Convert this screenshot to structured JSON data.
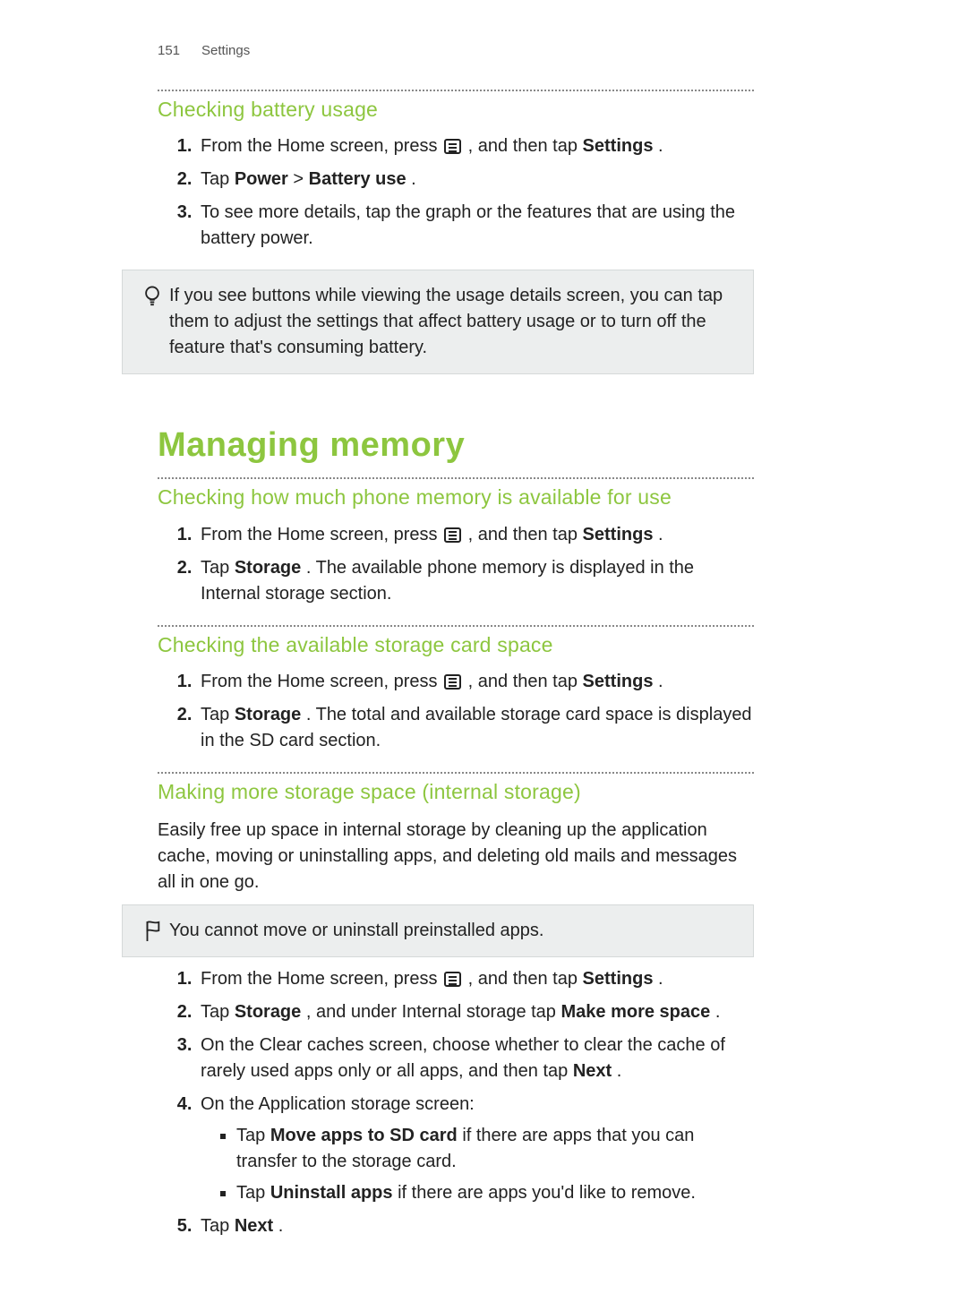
{
  "header": {
    "page_number": "151",
    "section": "Settings"
  },
  "sec_battery": {
    "title": "Checking battery usage",
    "steps": {
      "s1_pre": "From the Home screen, press ",
      "s1_post": " , and then tap ",
      "s1_kw": "Settings",
      "s1_end": ".",
      "s2_pre": "Tap ",
      "s2_kw1": "Power",
      "s2_mid": " > ",
      "s2_kw2": "Battery use",
      "s2_end": ".",
      "s3": "To see more details, tap the graph or the features that are using the battery power."
    },
    "tip": "If you see buttons while viewing the usage details screen, you can tap them to adjust the settings that affect battery usage or to turn off the feature that's consuming battery."
  },
  "main_heading": "Managing memory",
  "sec_mem_available": {
    "title": "Checking how much phone memory is available for use",
    "steps": {
      "s1_pre": "From the Home screen, press ",
      "s1_post": " , and then tap ",
      "s1_kw": "Settings",
      "s1_end": ".",
      "s2_pre": "Tap ",
      "s2_kw": "Storage",
      "s2_post": ". The available phone memory is displayed in the Internal storage section."
    }
  },
  "sec_card_space": {
    "title": "Checking the available storage card space",
    "steps": {
      "s1_pre": "From the Home screen, press ",
      "s1_post": " , and then tap ",
      "s1_kw": "Settings",
      "s1_end": ".",
      "s2_pre": "Tap ",
      "s2_kw": "Storage",
      "s2_post": ". The total and available storage card space is displayed in the SD card section."
    }
  },
  "sec_make_space": {
    "title": "Making more storage space (internal storage)",
    "intro": "Easily free up space in internal storage by cleaning up the application cache, moving or uninstalling apps, and deleting old mails and messages all in one go.",
    "note": "You cannot move or uninstall preinstalled apps.",
    "steps": {
      "s1_pre": "From the Home screen, press ",
      "s1_post": " , and then tap ",
      "s1_kw": "Settings",
      "s1_end": ".",
      "s2_pre": "Tap ",
      "s2_kw1": "Storage",
      "s2_mid": ", and under Internal storage tap ",
      "s2_kw2": "Make more space",
      "s2_end": ".",
      "s3_pre": "On the Clear caches screen, choose whether to clear the cache of rarely used apps only or all apps, and then tap ",
      "s3_kw": "Next",
      "s3_end": ".",
      "s4": "On the Application storage screen:",
      "s4a_pre": "Tap ",
      "s4a_kw": "Move apps to SD card",
      "s4a_post": " if there are apps that you can transfer to the storage card.",
      "s4b_pre": "Tap ",
      "s4b_kw": "Uninstall apps",
      "s4b_post": " if there are apps you'd like to remove.",
      "s5_pre": "Tap ",
      "s5_kw": "Next",
      "s5_end": "."
    }
  }
}
